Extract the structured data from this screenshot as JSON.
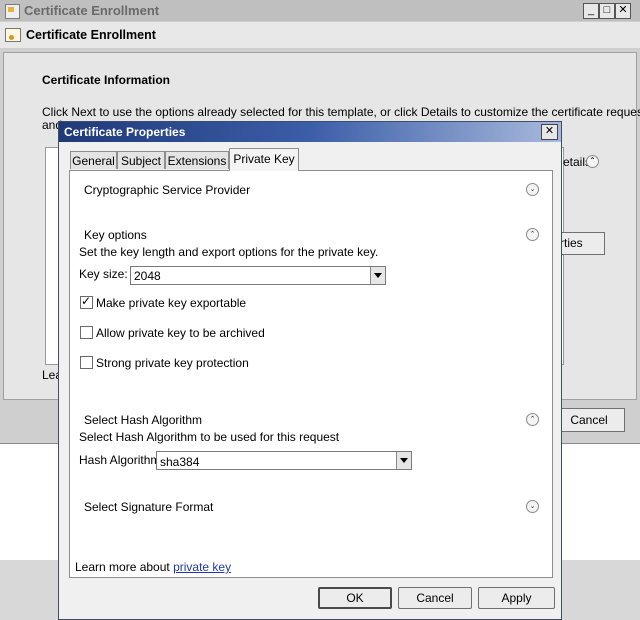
{
  "background_window": {
    "title": "Certificate Enrollment",
    "wizard_title": "Certificate Enrollment",
    "section_title": "Certificate Information",
    "description_line1": "Click Next to use the options already selected for this template, or click Details to customize the certificate request,",
    "description_line2": "and",
    "details_label": "etails",
    "properties_label": "rties",
    "learn_prefix": "Lea",
    "cancel_label": "Cancel",
    "controls": {
      "minimize": "_",
      "maximize": "□",
      "close": "✕"
    }
  },
  "dialog": {
    "title": "Certificate Properties",
    "close": "✕",
    "tabs": [
      {
        "label": "General"
      },
      {
        "label": "Subject"
      },
      {
        "label": "Extensions"
      },
      {
        "label": "Private Key",
        "selected": true
      }
    ],
    "sections": {
      "csp": {
        "title": "Cryptographic Service Provider",
        "expander": "⌄"
      },
      "key_options": {
        "title": "Key options",
        "expander": "⌃",
        "description": "Set the key length and export options for the private key.",
        "key_size_label": "Key size:",
        "key_size_value": "2048",
        "checkboxes": [
          {
            "label": "Make private key exportable",
            "checked": true
          },
          {
            "label": "Allow private key to be archived",
            "checked": false
          },
          {
            "label": "Strong private key protection",
            "checked": false
          }
        ]
      },
      "hash": {
        "title": "Select Hash Algorithm",
        "expander": "⌃",
        "description": "Select Hash Algorithm to be used for this request",
        "label": "Hash Algorithm:",
        "value": "sha384"
      },
      "signature": {
        "title": "Select Signature Format",
        "expander": "⌄"
      }
    },
    "learn_more_text": "Learn more about ",
    "learn_more_link": "private key",
    "buttons": {
      "ok": "OK",
      "cancel": "Cancel",
      "apply": "Apply"
    }
  }
}
